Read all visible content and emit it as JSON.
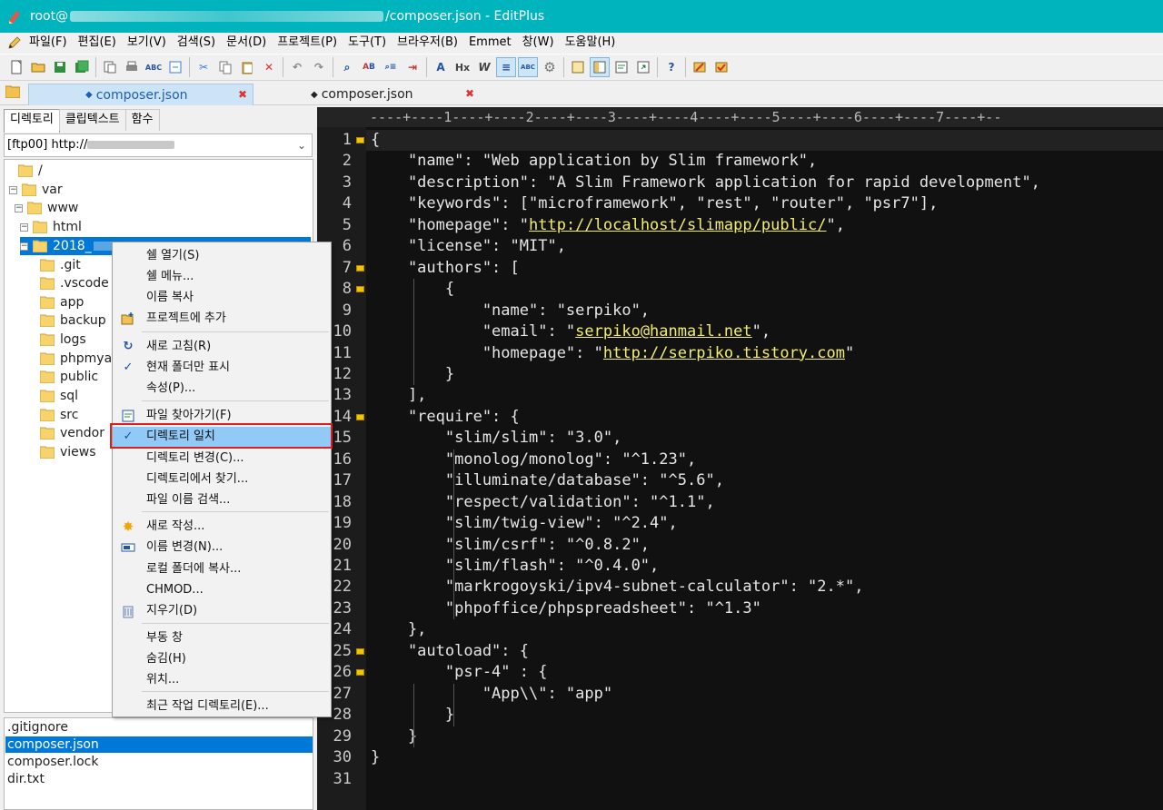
{
  "window": {
    "title_prefix": "root@",
    "title_suffix": "/composer.json - EditPlus"
  },
  "menubar": [
    "파일(F)",
    "편집(E)",
    "보기(V)",
    "검색(S)",
    "문서(D)",
    "프로젝트(P)",
    "도구(T)",
    "브라우저(B)",
    "Emmet",
    "창(W)",
    "도움말(H)"
  ],
  "tabs": [
    {
      "label": "composer.json",
      "active": true
    },
    {
      "label": "composer.json",
      "active": false
    }
  ],
  "sidebar": {
    "tabs": [
      "디렉토리",
      "클립텍스트",
      "함수"
    ],
    "ftp": "[ftp00] http://",
    "tree": [
      "/",
      "var",
      "www",
      "html",
      "2018_",
      ".git",
      ".vscode",
      "app",
      "backup",
      "logs",
      "phpmyac",
      "public",
      "sql",
      "src",
      "vendor",
      "views"
    ],
    "files": [
      ".gitignore",
      "composer.json",
      "composer.lock",
      "dir.txt"
    ]
  },
  "ruler": "----+----1----+----2----+----3----+----4----+----5----+----6----+----7----+--",
  "code_lines": [
    "{",
    "    \"name\": \"Web application by Slim framework\",",
    "    \"description\": \"A Slim Framework application for rapid development\",",
    "    \"keywords\": [\"microframework\", \"rest\", \"router\", \"psr7\"],",
    "    \"homepage\": \"http://localhost/slimapp/public/\",",
    "    \"license\": \"MIT\",",
    "    \"authors\": [",
    "        {",
    "            \"name\": \"serpiko\",",
    "            \"email\": \"serpiko@hanmail.net\",",
    "            \"homepage\": \"http://serpiko.tistory.com\"",
    "        }",
    "    ],",
    "    \"require\": {",
    "        \"slim/slim\": \"3.0\",",
    "        \"monolog/monolog\": \"^1.23\",",
    "        \"illuminate/database\": \"^5.6\",",
    "        \"respect/validation\": \"^1.1\",",
    "        \"slim/twig-view\": \"^2.4\",",
    "        \"slim/csrf\": \"^0.8.2\",",
    "        \"slim/flash\": \"^0.4.0\",",
    "        \"markrogoyski/ipv4-subnet-calculator\": \"2.*\",",
    "        \"phpoffice/phpspreadsheet\": \"^1.3\"",
    "    },",
    "    \"autoload\": {",
    "        \"psr-4\" : {",
    "            \"App\\\\\": \"app\"",
    "        }",
    "    }",
    "}",
    ""
  ],
  "line_numbers": [
    "1",
    "2",
    "3",
    "4",
    "5",
    "6",
    "7",
    "8",
    "9",
    "10",
    "11",
    "12",
    "13",
    "14",
    "15",
    "16",
    "17",
    "18",
    "19",
    "20",
    "21",
    "22",
    "23",
    "24",
    "25",
    "26",
    "27",
    "28",
    "29",
    "30",
    "31"
  ],
  "links": {
    "homepage": "http://localhost/slimapp/public/",
    "email": "serpiko@hanmail.net",
    "author_homepage": "http://serpiko.tistory.com"
  },
  "context_menu": [
    {
      "label": "쉘 열기(S)",
      "icon": ""
    },
    {
      "label": "쉘 메뉴...",
      "icon": ""
    },
    {
      "label": "이름 복사",
      "icon": ""
    },
    {
      "label": "프로젝트에 추가",
      "icon": "folder-add-icon"
    },
    {
      "label": "새로 고침(R)",
      "icon": "refresh-icon"
    },
    {
      "label": "현재 폴더만 표시",
      "icon": "check-icon"
    },
    {
      "label": "속성(P)...",
      "icon": ""
    },
    {
      "label": "파일 찾아가기(F)",
      "icon": "find-file-icon"
    },
    {
      "label": "디렉토리 일치",
      "icon": "check-icon"
    },
    {
      "label": "디렉토리 변경(C)...",
      "icon": ""
    },
    {
      "label": "디렉토리에서 찾기...",
      "icon": ""
    },
    {
      "label": "파일 이름 검색...",
      "icon": ""
    },
    {
      "label": "새로 작성...",
      "icon": "new-sparkle-icon"
    },
    {
      "label": "이름 변경(N)...",
      "icon": "rename-icon"
    },
    {
      "label": "로컬 폴더에 복사...",
      "icon": ""
    },
    {
      "label": "CHMOD...",
      "icon": ""
    },
    {
      "label": "지우기(D)",
      "icon": "trash-icon"
    },
    {
      "label": "부동 창",
      "icon": ""
    },
    {
      "label": "숨김(H)",
      "icon": ""
    },
    {
      "label": "위치...",
      "icon": ""
    },
    {
      "label": "최근 작업 디렉토리(E)...",
      "icon": ""
    }
  ],
  "colors": {
    "titlebar": "#00b4bd",
    "selection": "#0078d7",
    "menu_highlight": "#91c9f7",
    "link": "#f2ee6d",
    "fold_marker": "#f4c400"
  }
}
